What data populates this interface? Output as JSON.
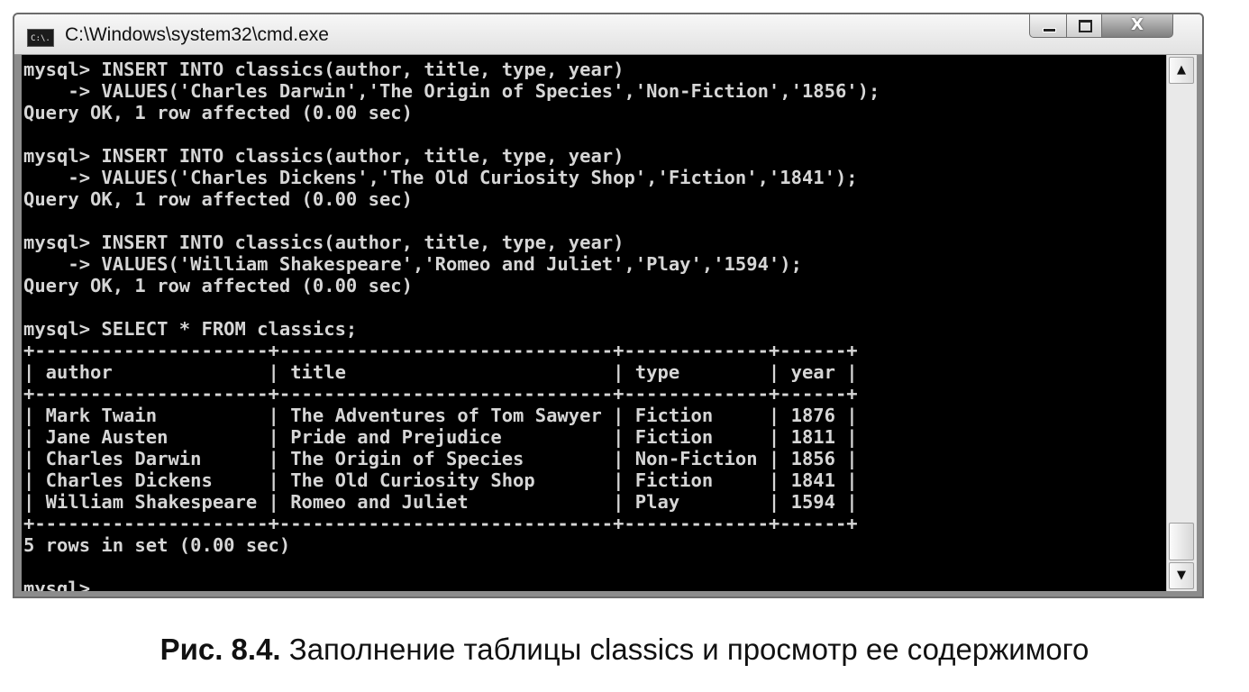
{
  "window": {
    "title": "C:\\Windows\\system32\\cmd.exe",
    "icon_text": "C:\\.",
    "controls": {
      "minimize": "minimize",
      "maximize": "maximize",
      "close": "X"
    }
  },
  "console": {
    "lines": [
      "mysql> INSERT INTO classics(author, title, type, year)",
      "    -> VALUES('Charles Darwin','The Origin of Species','Non-Fiction','1856');",
      "Query OK, 1 row affected (0.00 sec)",
      "",
      "mysql> INSERT INTO classics(author, title, type, year)",
      "    -> VALUES('Charles Dickens','The Old Curiosity Shop','Fiction','1841');",
      "Query OK, 1 row affected (0.00 sec)",
      "",
      "mysql> INSERT INTO classics(author, title, type, year)",
      "    -> VALUES('William Shakespeare','Romeo and Juliet','Play','1594');",
      "Query OK, 1 row affected (0.00 sec)",
      "",
      "mysql> SELECT * FROM classics;",
      "+---------------------+------------------------------+-------------+------+",
      "| author              | title                        | type        | year |",
      "+---------------------+------------------------------+-------------+------+",
      "| Mark Twain          | The Adventures of Tom Sawyer | Fiction     | 1876 |",
      "| Jane Austen         | Pride and Prejudice          | Fiction     | 1811 |",
      "| Charles Darwin      | The Origin of Species        | Non-Fiction | 1856 |",
      "| Charles Dickens     | The Old Curiosity Shop       | Fiction     | 1841 |",
      "| William Shakespeare | Romeo and Juliet             | Play        | 1594 |",
      "+---------------------+------------------------------+-------------+------+",
      "5 rows in set (0.00 sec)",
      ""
    ],
    "prompt": "mysql> ",
    "colors": {
      "background": "#000000",
      "text": "#d6d6d6"
    }
  },
  "scrollbar": {
    "up_arrow": "▲",
    "down_arrow": "▼"
  },
  "caption": {
    "label": "Рис. 8.4.",
    "text": " Заполнение таблицы classics и просмотр ее содержимого"
  }
}
